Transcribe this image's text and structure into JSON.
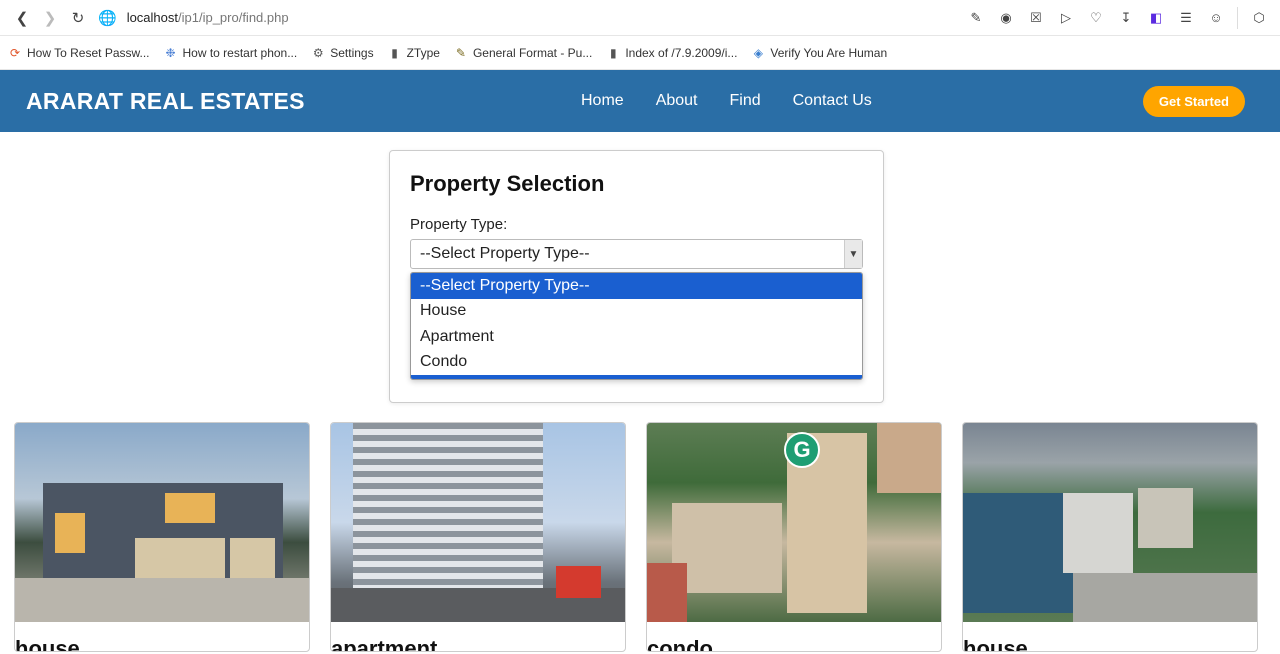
{
  "browser": {
    "url_host": "localhost",
    "url_path": "/ip1/ip_pro/find.php"
  },
  "bookmarks": [
    {
      "label": "How To Reset Passw...",
      "icon": "reset-icon"
    },
    {
      "label": "How to restart phon...",
      "icon": "bird-icon"
    },
    {
      "label": "Settings",
      "icon": "gear-icon"
    },
    {
      "label": "ZType",
      "icon": "file-icon"
    },
    {
      "label": "General Format - Pu...",
      "icon": "pen-icon"
    },
    {
      "label": "Index of /7.9.2009/i...",
      "icon": "file-icon"
    },
    {
      "label": "Verify You Are Human",
      "icon": "shield-icon"
    }
  ],
  "header": {
    "logo": "ARARAT REAL ESTATES",
    "nav": [
      "Home",
      "About",
      "Find",
      "Contact Us"
    ],
    "cta": "Get Started"
  },
  "form": {
    "title": "Property Selection",
    "label": "Property Type:",
    "selected": "--Select Property Type--",
    "options": [
      "--Select Property Type--",
      "House",
      "Apartment",
      "Condo"
    ]
  },
  "cards": [
    {
      "label": "house",
      "image": "modern-house-photo"
    },
    {
      "label": "apartment",
      "image": "apartment-building-photo"
    },
    {
      "label": "condo",
      "image": "condo-towers-photo"
    },
    {
      "label": "house",
      "image": "suburban-houses-photo"
    }
  ]
}
